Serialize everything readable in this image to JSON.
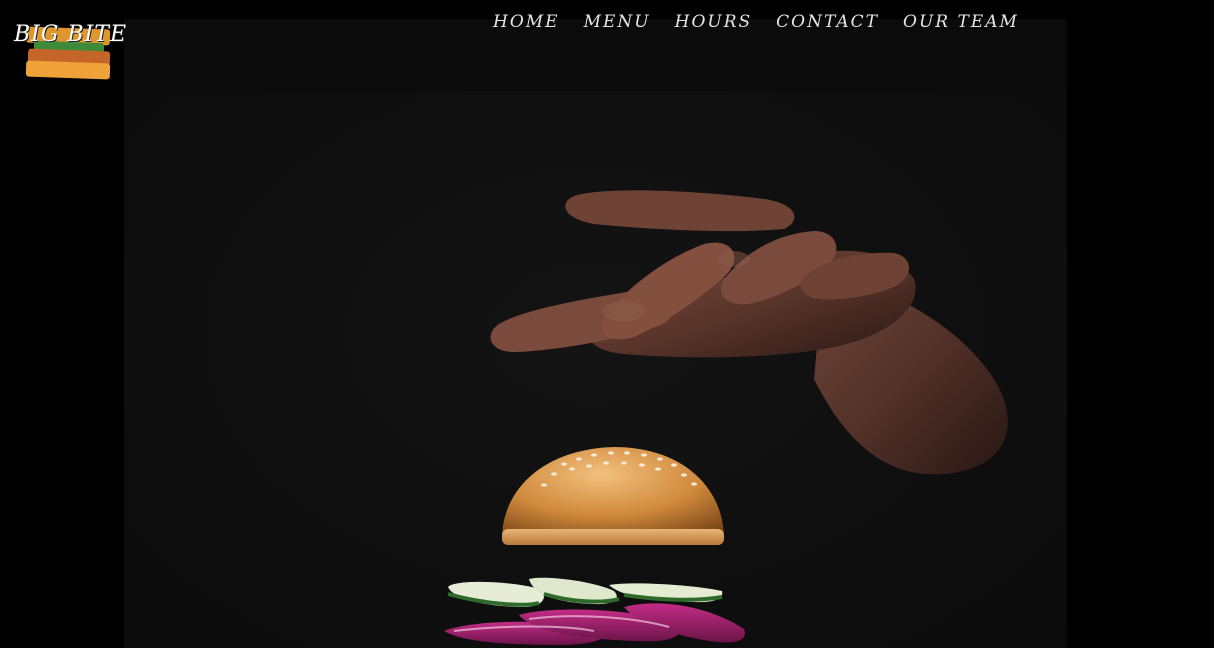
{
  "brand": {
    "name": "BIG BITE",
    "logo_colors": [
      "#e0962f",
      "#3d8a3b",
      "#c5652a",
      "#f0a23a"
    ]
  },
  "nav": {
    "items": [
      {
        "label": "HOME"
      },
      {
        "label": "MENU"
      },
      {
        "label": "HOURS"
      },
      {
        "label": "CONTACT"
      },
      {
        "label": "OUR TEAM"
      }
    ]
  },
  "hero": {
    "image": "hand-dropping-burger-bun-onion-cucumber-photo"
  },
  "colors": {
    "background": "#000000",
    "panel": "#0e0e0e",
    "nav_text": "#e6e6e6"
  }
}
